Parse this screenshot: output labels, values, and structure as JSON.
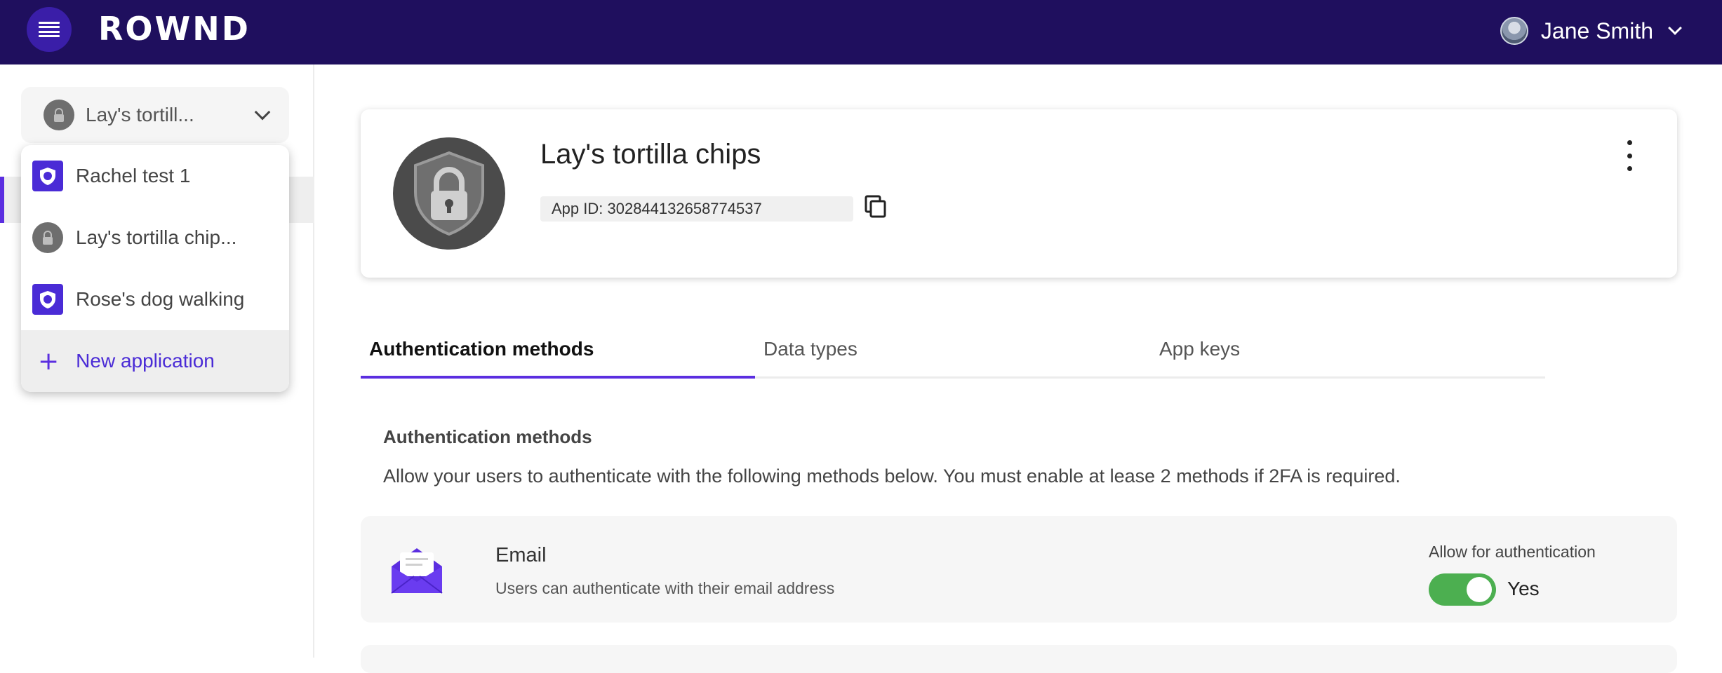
{
  "brand": {
    "name": "ROWND"
  },
  "user": {
    "name": "Jane Smith"
  },
  "sidebar": {
    "selected_app": "Lay's tortill...",
    "dropdown": {
      "items": [
        {
          "label": "Rachel test 1",
          "icon": "shield-logo-icon"
        },
        {
          "label": "Lay's tortilla chip...",
          "icon": "lock-icon"
        },
        {
          "label": "Rose's dog walking",
          "icon": "shield-logo-icon"
        }
      ],
      "new_label": "New application"
    }
  },
  "app": {
    "title": "Lay's tortilla chips",
    "app_id": "App ID: 302844132658774537"
  },
  "tabs": [
    {
      "label": "Authentication methods",
      "active": true
    },
    {
      "label": "Data types",
      "active": false
    },
    {
      "label": "App keys",
      "active": false
    }
  ],
  "auth": {
    "title": "Authentication methods",
    "description": "Allow your users to authenticate with the following methods below. You must enable at lease 2 methods if 2FA is required.",
    "methods": [
      {
        "name": "Email",
        "description": "Users can authenticate with their email address",
        "allow_label": "Allow for authentication",
        "enabled_label": "Yes",
        "enabled": true
      }
    ]
  },
  "colors": {
    "topbar": "#1f0f5e",
    "accent": "#5b2ee0",
    "toggle_on": "#4caf50"
  }
}
